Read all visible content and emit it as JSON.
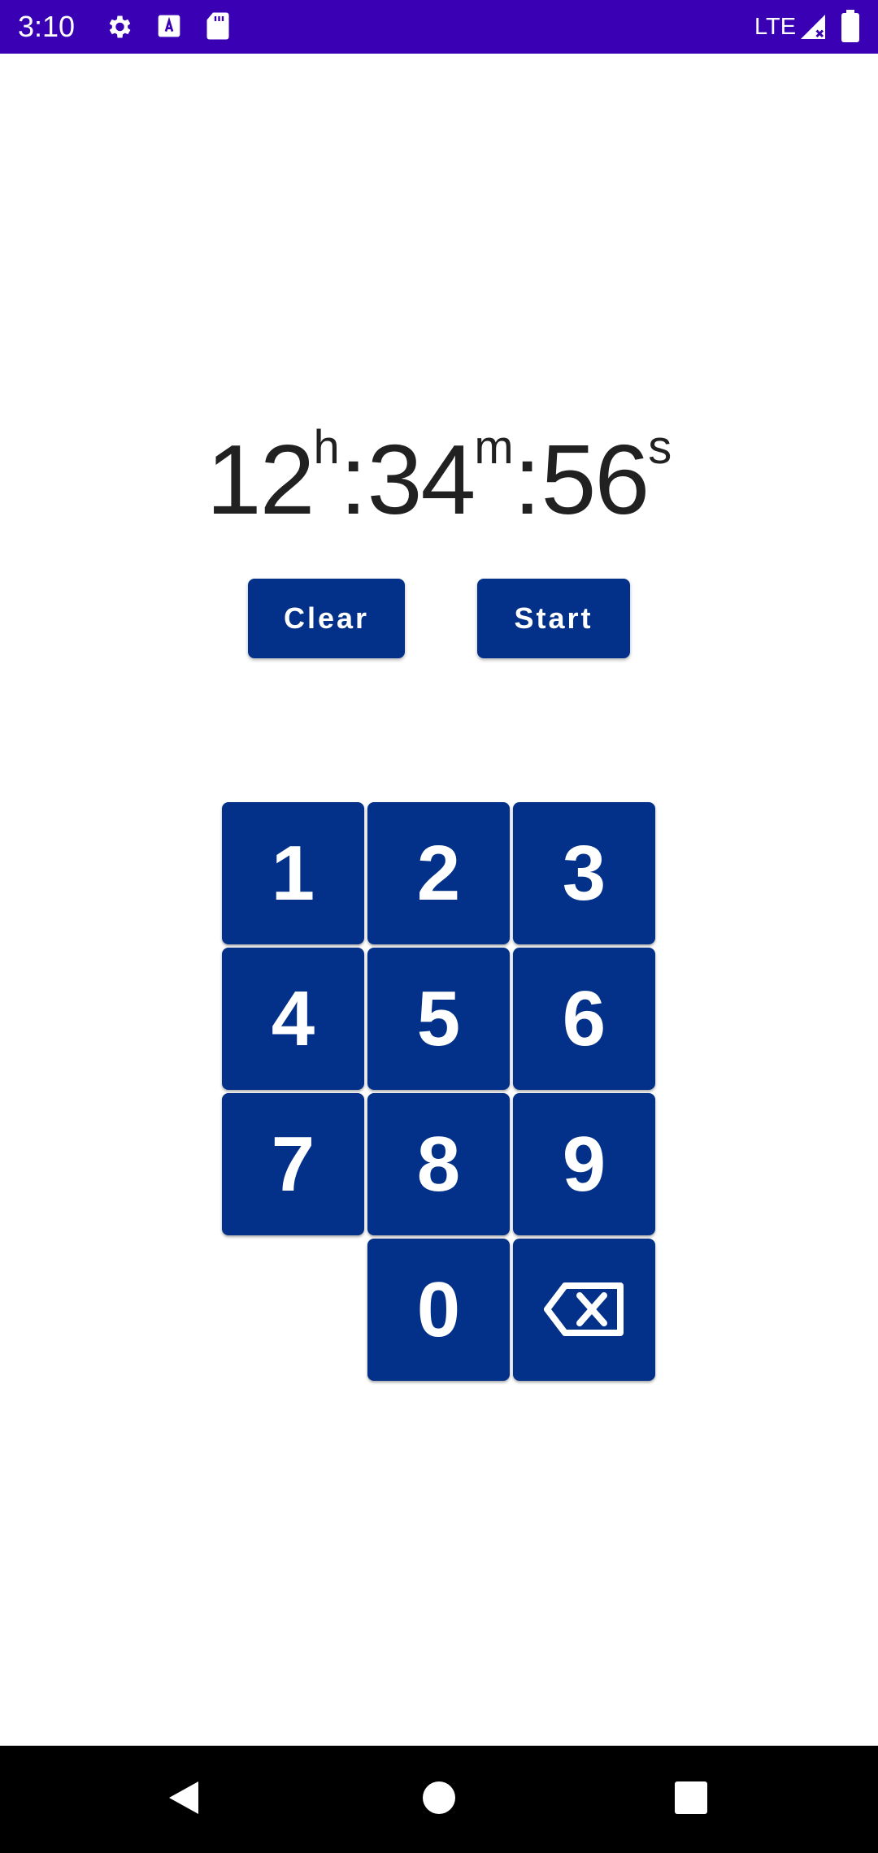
{
  "status_bar": {
    "time": "3:10",
    "network": "LTE",
    "icons": [
      "gear-icon",
      "font-download-icon",
      "sd-card-icon",
      "signal-icon",
      "battery-icon"
    ],
    "background_color": "#3A00B4"
  },
  "timer": {
    "hours": "12",
    "hours_unit": "h",
    "minutes": "34",
    "minutes_unit": "m",
    "seconds": "56",
    "seconds_unit": "s",
    "separator": ":"
  },
  "actions": {
    "clear_label": "Clear",
    "start_label": "Start"
  },
  "keypad": {
    "keys": [
      "1",
      "2",
      "3",
      "4",
      "5",
      "6",
      "7",
      "8",
      "9",
      "0"
    ],
    "backspace_icon": "backspace-icon",
    "key_color": "#03318A"
  },
  "nav_bar": {
    "buttons": [
      "back-icon",
      "home-icon",
      "recents-icon"
    ]
  }
}
